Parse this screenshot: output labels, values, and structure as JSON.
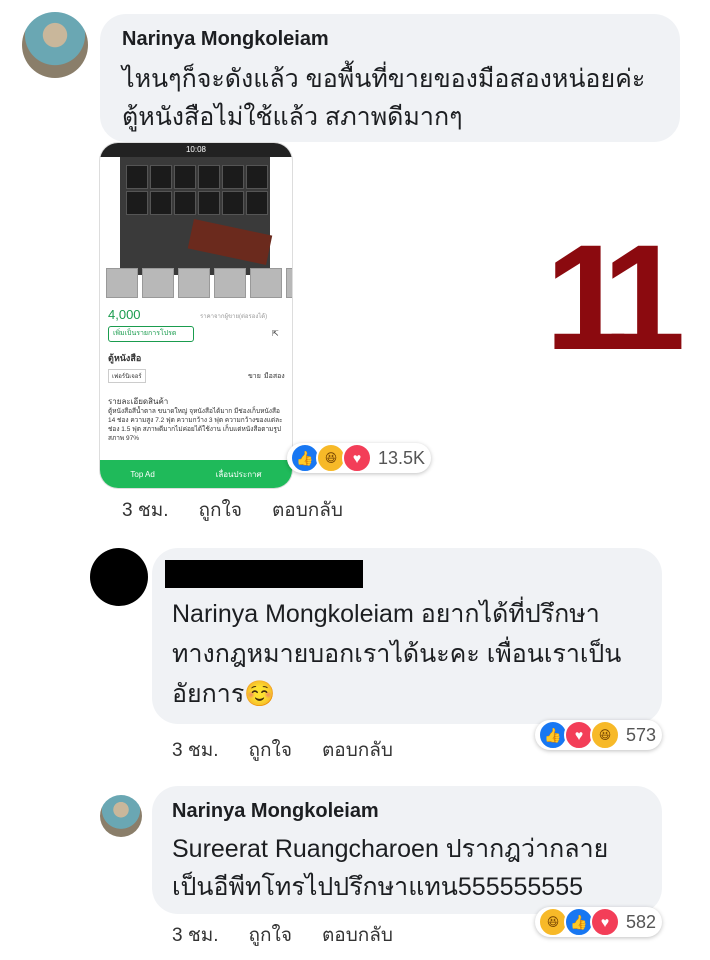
{
  "comments": [
    {
      "author": "Narinya Mongkoleiam",
      "lines": [
        "ไหนๆก็จะดังแล้ว ขอพื้นที่ขายของมือสองหน่อยค่ะ",
        "ตู้หนังสือไม่ใช้แล้ว สภาพดีมากๆ"
      ],
      "time": "3 ชม.",
      "like": "ถูกใจ",
      "reply": "ตอบกลับ",
      "reactions": {
        "icons": [
          "like-icon",
          "haha-icon",
          "love-icon"
        ],
        "count": "13.5K"
      },
      "attachment": {
        "status_time": "10:08",
        "price": "4,000",
        "price_note": "ราคาจากผู้ขาย(ต่อรองได้)",
        "make_offer": "เพิ่มเป็นรายการโปรด",
        "title": "ตู้หนังสือ",
        "tag": "เฟอร์นิเจอร์",
        "sale_type": "ขาย",
        "condition": "มือสอง",
        "details_header": "รายละเอียดสินค้า",
        "details": "ตู้หนังสือสีน้ำตาล ขนาดใหญ่ จุหนังสือได้มาก มีช่องเก็บหนังสือ 14 ช่อง ความสูง 7.2 ฟุต ความกว้าง 3 ฟุต ความกว้างของแต่ละช่อง 1.5 ฟุต สภาพดีมากไม่ค่อยได้ใช้งาน เก็บแต่หนังสือตามรูป สภาพ 97%",
        "top_ad": "Top Ad",
        "announce": "เลื่อนประกาศ"
      },
      "overlay_number": "11"
    },
    {
      "author": "",
      "lines": [
        "Narinya Mongkoleiam  อยากได้ที่ปรึกษา",
        "ทางกฎหมายบอกเราได้นะคะ เพื่อนเราเป็น",
        "อัยการ☺️"
      ],
      "time": "3 ชม.",
      "like": "ถูกใจ",
      "reply": "ตอบกลับ",
      "reactions": {
        "icons": [
          "like-icon",
          "love-icon",
          "haha-icon"
        ],
        "count": "573"
      }
    },
    {
      "author": "Narinya Mongkoleiam",
      "lines": [
        "Sureerat Ruangcharoen ปรากฎว่ากลาย",
        "เป็นอีพีทโทรไปปรึกษาแทน555555555"
      ],
      "time": "3 ชม.",
      "like": "ถูกใจ",
      "reply": "ตอบกลับ",
      "reactions": {
        "icons": [
          "haha-icon",
          "like-icon",
          "love-icon"
        ],
        "count": "582"
      }
    }
  ],
  "colors": {
    "accent": "#1877f2",
    "love": "#f33e58",
    "haha": "#f7b928",
    "number": "#8b0a0f",
    "bubble": "#f0f2f5"
  }
}
